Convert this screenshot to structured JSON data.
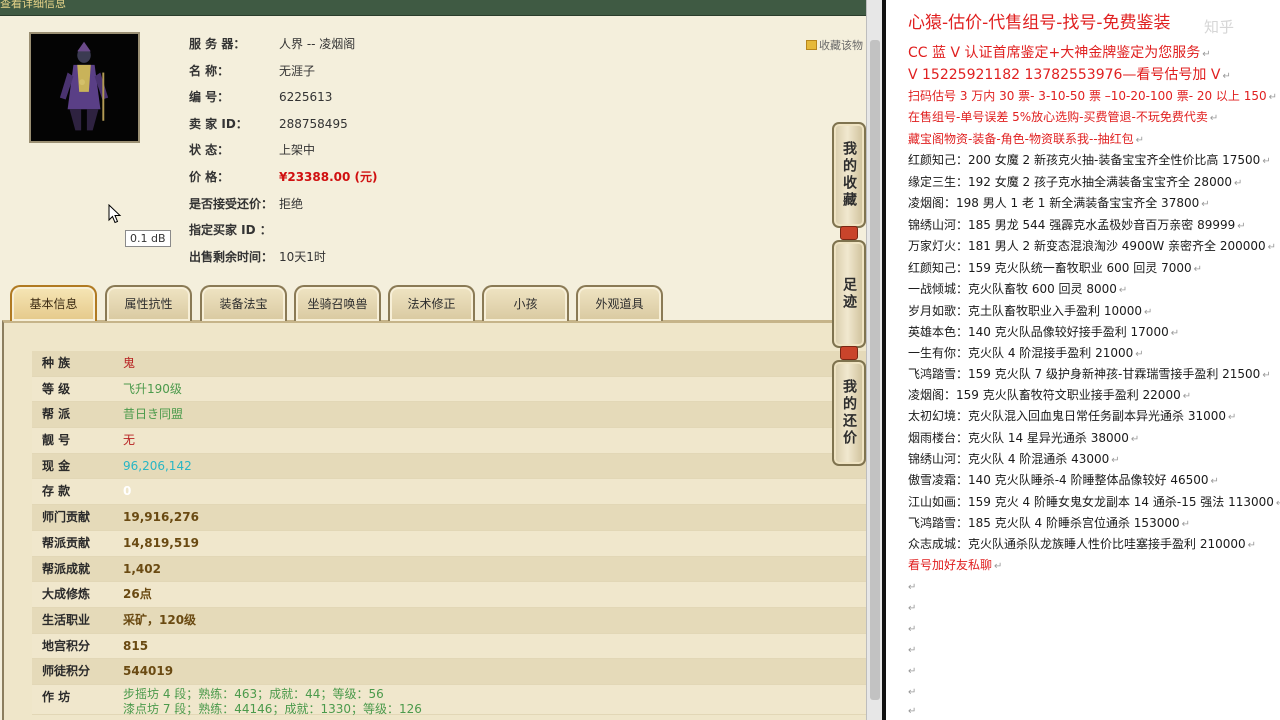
{
  "topbar": {
    "title": "查看详细信息"
  },
  "seller": {
    "rows": [
      {
        "label": "服 务 器：",
        "value": "人界 -- 凌烟阁"
      },
      {
        "label": "名      称：",
        "value": "无涯子"
      },
      {
        "label": "编      号：",
        "value": "6225613"
      },
      {
        "label": "卖   家   ID：",
        "value": "288758495"
      },
      {
        "label": "状      态：",
        "value": "上架中"
      },
      {
        "label": "价      格：",
        "value": "¥23388.00 (元)"
      },
      {
        "label": "是否接受还价：",
        "value": "拒绝"
      },
      {
        "label": "指定买家 ID ：",
        "value": ""
      },
      {
        "label": "出售剩余时间：",
        "value": "10天1时"
      }
    ]
  },
  "favorite": {
    "label": "收藏该物"
  },
  "tooltip": {
    "text": "0.1 dB"
  },
  "tabs": [
    "基本信息",
    "属性抗性",
    "装备法宝",
    "坐骑召唤兽",
    "法术修正",
    "小孩",
    "外观道具"
  ],
  "side_buttons": [
    "我的收藏",
    "足迹",
    "我的还价"
  ],
  "detail": [
    {
      "label": "种    族",
      "value": "鬼"
    },
    {
      "label": "等    级",
      "value": "飞升190级"
    },
    {
      "label": "帮    派",
      "value": "昔日き同盟"
    },
    {
      "label": "靓    号",
      "value": "无"
    },
    {
      "label": "现    金",
      "value": "96,206,142"
    },
    {
      "label": "存    款",
      "value": "0"
    },
    {
      "label": "师门贡献",
      "value": "19,916,276"
    },
    {
      "label": "帮派贡献",
      "value": "14,819,519"
    },
    {
      "label": "帮派成就",
      "value": "1,402"
    },
    {
      "label": "大成修炼",
      "value": "26点"
    },
    {
      "label": "生活职业",
      "value": "采矿，120级"
    },
    {
      "label": "地宫积分",
      "value": "815"
    },
    {
      "label": "师徒积分",
      "value": "544019"
    },
    {
      "label": "作    坊",
      "value": "步摇坊 4 段；熟练：463；成就：44；等级：56",
      "value2": "漆点坊 7 段；熟练：44146；成就：1330；等级：126"
    }
  ],
  "notes": {
    "watermark": "知乎",
    "lines": [
      "心猿-估价-代售组号-找号-免费鉴装",
      "CC 蓝 V 认证首席鉴定+大神金牌鉴定为您服务",
      "V 15225921182      13782553976—看号估号加 V",
      "扫码估号 3 万内 30 票- 3-10-50 票  –10-20-100 票- 20 以上 150",
      "在售组号-单号误差 5%放心选购-买费管退-不玩免费代卖",
      "藏宝阁物资-装备-角色-物资联系我--抽红包",
      "红颜知己：200 女魔 2 新孩克火抽-装备宝宝齐全性价比高 17500",
      "缘定三生：192 女魔 2 孩子克水抽全满装备宝宝齐全 28000",
      "凌烟阁：198 男人 1 老 1 新全满装备宝宝齐全 37800",
      "锦绣山河：185 男龙 544 强霹克水孟极妙音百万亲密 89999",
      "万家灯火：181 男人 2 新变态混浪淘沙 4900W 亲密齐全 200000",
      "红颜知己：159 克火队统一畜牧职业 600 回灵 7000",
      "一战倾城：克火队畜牧 600 回灵 8000",
      "岁月如歌：克土队畜牧职业入手盈利 10000",
      "英雄本色：140 克火队品像较好接手盈利 17000",
      "一生有你：克火队 4 阶混接手盈利 21000",
      "飞鸿踏雪：159 克火队 7 级护身新神孩-甘霖瑞雪接手盈利 21500",
      "凌烟阁：159 克火队畜牧符文职业接手盈利 22000",
      "太初幻境：克火队混入回血鬼日常任务副本异光通杀 31000",
      "烟雨楼台：克火队 14 星异光通杀 38000",
      "锦绣山河：克火队 4 阶混通杀 43000",
      "傲雪凌霜：140 克火队睡杀-4 阶睡整体品像较好 46500",
      "江山如画：159 克火 4 阶睡女鬼女龙副本 14 通杀-15 强法 113000",
      "飞鸿踏雪：185 克火队 4 阶睡杀宫位通杀 153000",
      "众志成城：克火队通杀队龙族睡人性价比哇塞接手盈利 210000",
      "看号加好友私聊"
    ]
  },
  "colors": {
    "accent_red": "#e02020",
    "price_red": "#d01010",
    "tab_gold": "#b07a22",
    "green_text": "#4b9a4b",
    "cyan_text": "#29b6c4"
  }
}
